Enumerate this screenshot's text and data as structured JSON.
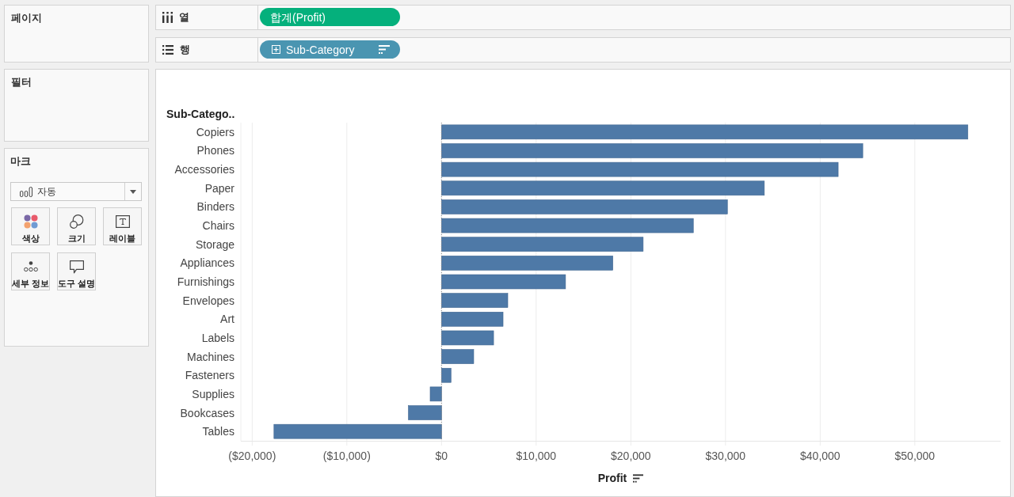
{
  "pages_panel": {
    "title": "페이지"
  },
  "filters_panel": {
    "title": "필터"
  },
  "marks_panel": {
    "title": "마크",
    "mark_type": "자동",
    "properties": [
      {
        "label": "색상",
        "kind": "color"
      },
      {
        "label": "크기",
        "kind": "size"
      },
      {
        "label": "레이블",
        "kind": "label"
      },
      {
        "label": "세부 정보",
        "kind": "detail"
      },
      {
        "label": "도구 설명",
        "kind": "tooltip"
      }
    ]
  },
  "shelves": [
    {
      "label": "열",
      "kind": "columns",
      "pills": [
        {
          "label": "합계(Profit)",
          "kind": "measure",
          "sorted": false
        }
      ]
    },
    {
      "label": "행",
      "kind": "rows",
      "pills": [
        {
          "label": "Sub-Category",
          "kind": "dimension",
          "sorted": true
        }
      ]
    }
  ],
  "view": {
    "x_axis_sorted": true,
    "chart_data": {
      "type": "bar",
      "orientation": "horizontal",
      "ylabel": "Sub-Catego..",
      "xlabel": "Profit",
      "categories": [
        "Copiers",
        "Phones",
        "Accessories",
        "Paper",
        "Binders",
        "Chairs",
        "Storage",
        "Appliances",
        "Furnishings",
        "Envelopes",
        "Art",
        "Labels",
        "Machines",
        "Fasteners",
        "Supplies",
        "Bookcases",
        "Tables"
      ],
      "values": [
        55600,
        44500,
        41900,
        34100,
        30200,
        26600,
        21300,
        18100,
        13100,
        7000,
        6500,
        5500,
        3400,
        1000,
        -1200,
        -3500,
        -17700
      ],
      "xlim": [
        -21200,
        59050
      ],
      "xticks": [
        {
          "value": -20000,
          "label": "($20,000)"
        },
        {
          "value": -10000,
          "label": "($10,000)"
        },
        {
          "value": 0,
          "label": "$0"
        },
        {
          "value": 10000,
          "label": "$10,000"
        },
        {
          "value": 20000,
          "label": "$20,000"
        },
        {
          "value": 30000,
          "label": "$30,000"
        },
        {
          "value": 40000,
          "label": "$40,000"
        },
        {
          "value": 50000,
          "label": "$50,000"
        }
      ],
      "grid": true,
      "ref_lines": [
        {
          "axis": "x",
          "value": 0
        }
      ]
    }
  }
}
